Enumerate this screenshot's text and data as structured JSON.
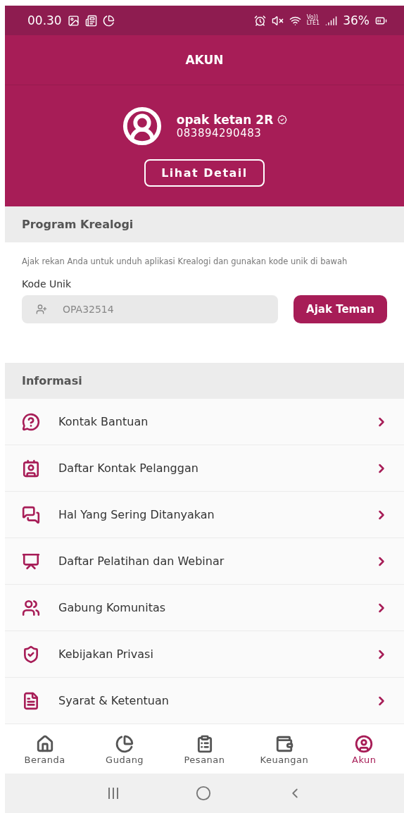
{
  "status_bar": {
    "time": "00.30",
    "network": [
      "Vo))",
      "LTE1"
    ],
    "battery": "36%"
  },
  "header": {
    "title": "AKUN"
  },
  "profile": {
    "name": "opak ketan 2R",
    "verified": true,
    "phone": "083894290483",
    "detail_button": "Lihat Detail"
  },
  "program": {
    "title": "Program Krealogi",
    "description": "Ajak rekan Anda untuk unduh aplikasi Krealogi dan gunakan kode unik di bawah",
    "code_label": "Kode Unik",
    "code": "OPA32514",
    "invite_button": "Ajak Teman"
  },
  "info": {
    "title": "Informasi",
    "items": [
      {
        "label": "Kontak Bantuan"
      },
      {
        "label": "Daftar Kontak Pelanggan"
      },
      {
        "label": "Hal Yang Sering Ditanyakan"
      },
      {
        "label": "Daftar Pelatihan dan Webinar"
      },
      {
        "label": "Gabung Komunitas"
      },
      {
        "label": "Kebijakan Privasi"
      },
      {
        "label": "Syarat & Ketentuan"
      }
    ]
  },
  "tabs": [
    {
      "label": "Beranda",
      "selected": false
    },
    {
      "label": "Gudang",
      "selected": false
    },
    {
      "label": "Pesanan",
      "selected": false
    },
    {
      "label": "Keuangan",
      "selected": false
    },
    {
      "label": "Akun",
      "selected": true
    }
  ]
}
